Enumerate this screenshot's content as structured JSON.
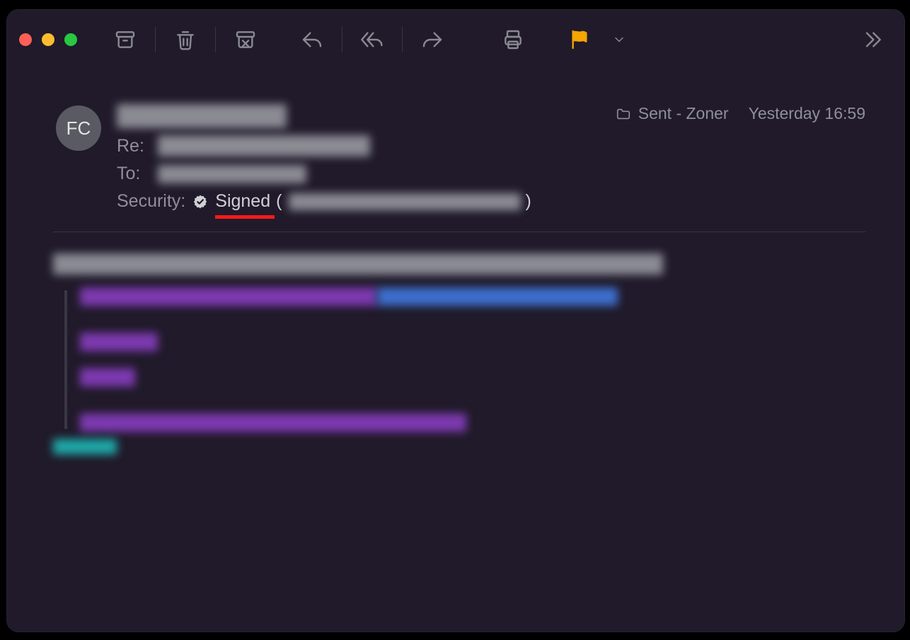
{
  "avatar_initials": "FC",
  "labels": {
    "re": "Re:",
    "to": "To:",
    "security": "Security:"
  },
  "security": {
    "status": "Signed",
    "open_paren": "(",
    "close_paren": ")"
  },
  "folder": {
    "name": "Sent - Zoner"
  },
  "timestamp": "Yesterday 16:59",
  "colors": {
    "flag": "#f5a500",
    "underline": "#ff1a1a"
  },
  "toolbar_icons": [
    "archive-icon",
    "trash-icon",
    "junk-icon",
    "reply-icon",
    "reply-all-icon",
    "forward-icon",
    "print-icon",
    "flag-icon",
    "flag-menu-icon",
    "more-icon"
  ]
}
